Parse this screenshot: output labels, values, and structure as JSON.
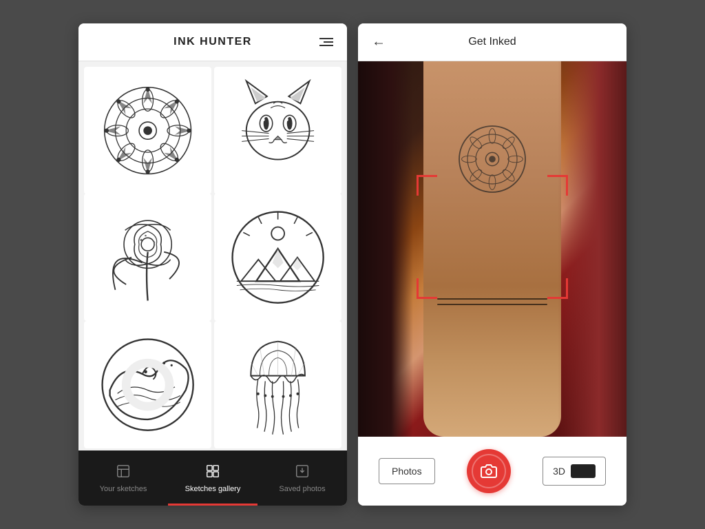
{
  "left_screen": {
    "header": {
      "title": "INK HUNTER",
      "menu_icon_label": "menu"
    },
    "sketches": [
      {
        "id": "mandala",
        "alt": "Mandala tattoo sketch"
      },
      {
        "id": "cat",
        "alt": "Cat head tattoo sketch"
      },
      {
        "id": "flower",
        "alt": "Flower tattoo sketch"
      },
      {
        "id": "mountain",
        "alt": "Mountain landscape tattoo sketch"
      },
      {
        "id": "wave",
        "alt": "Wave tattoo sketch"
      },
      {
        "id": "jellyfish",
        "alt": "Jellyfish tattoo sketch"
      }
    ],
    "bottom_nav": [
      {
        "id": "your-sketches",
        "label": "Your sketches",
        "active": false
      },
      {
        "id": "sketches-gallery",
        "label": "Sketches gallery",
        "active": true
      },
      {
        "id": "saved-photos",
        "label": "Saved photos",
        "active": false
      }
    ]
  },
  "right_screen": {
    "header": {
      "title": "Get Inked",
      "back_label": "back"
    },
    "controls": {
      "photos_label": "Photos",
      "mode_label": "3D",
      "shutter_label": "Take photo"
    }
  }
}
